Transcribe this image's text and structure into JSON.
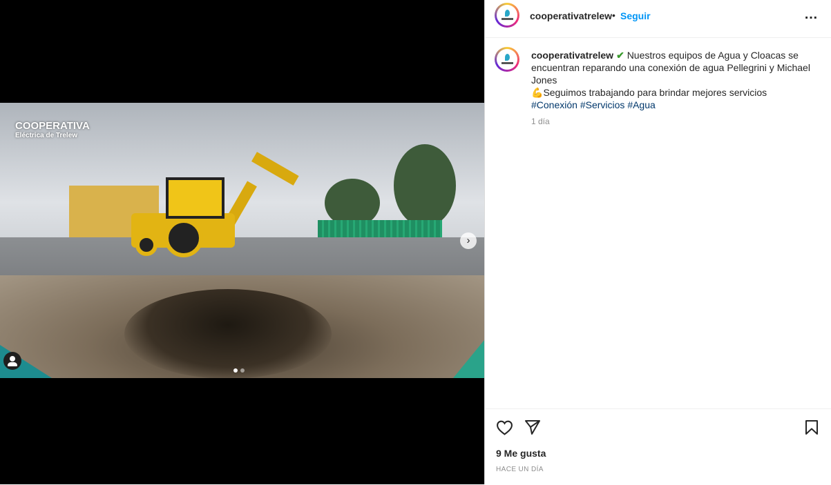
{
  "post": {
    "username": "cooperativatrelew",
    "bullet": "•",
    "follow_label": "Seguir",
    "more_label": "…"
  },
  "media": {
    "watermark_title": "COOPERATIVA",
    "watermark_subtitle": "Eléctrica de Trelew",
    "next_glyph": "›",
    "slide_count": 2,
    "active_slide": 1
  },
  "caption": {
    "username": "cooperativatrelew",
    "check_emoji": "✔",
    "line1": "Nuestros equipos de Agua y Cloacas se encuentran reparando una conexión de agua Pellegrini y Michael Jones",
    "muscle_emoji": "💪",
    "line2": "Seguimos trabajando para brindar mejores servicios",
    "hashtags": [
      "#Conexión",
      "#Servicios",
      "#Agua"
    ],
    "time": "1 día"
  },
  "actions": {
    "like_icon": "heart-icon",
    "share_icon": "paper-plane-icon",
    "save_icon": "bookmark-icon"
  },
  "stats": {
    "likes": "9 Me gusta",
    "posted_ago": "HACE UN DÍA"
  },
  "colors": {
    "follow": "#0095f6",
    "hashtag": "#00376b",
    "muted": "#8e8e8e",
    "text": "#262626"
  }
}
